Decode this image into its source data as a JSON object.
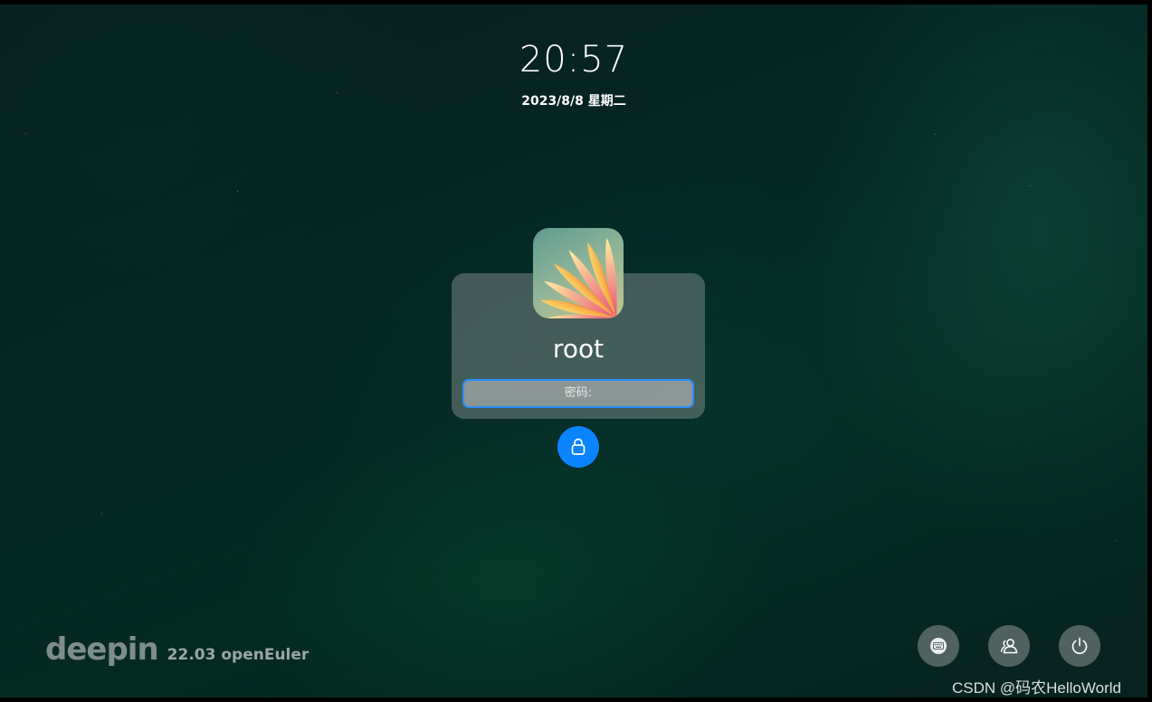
{
  "clock": {
    "time": "20:57",
    "date": "2023/8/8 星期二"
  },
  "login": {
    "username": "root",
    "password_placeholder": "密码:",
    "avatar_icon": "flower-avatar",
    "unlock_icon": "lock-icon"
  },
  "branding": {
    "logo": "deepin",
    "version": "22.03 openEuler"
  },
  "system_buttons": [
    {
      "icon": "keyboard-icon"
    },
    {
      "icon": "switch-user-icon"
    },
    {
      "icon": "power-icon"
    }
  ],
  "watermark": "CSDN @码农HelloWorld",
  "colors": {
    "accent": "#0a84ff",
    "input_border": "#2a8fff"
  }
}
